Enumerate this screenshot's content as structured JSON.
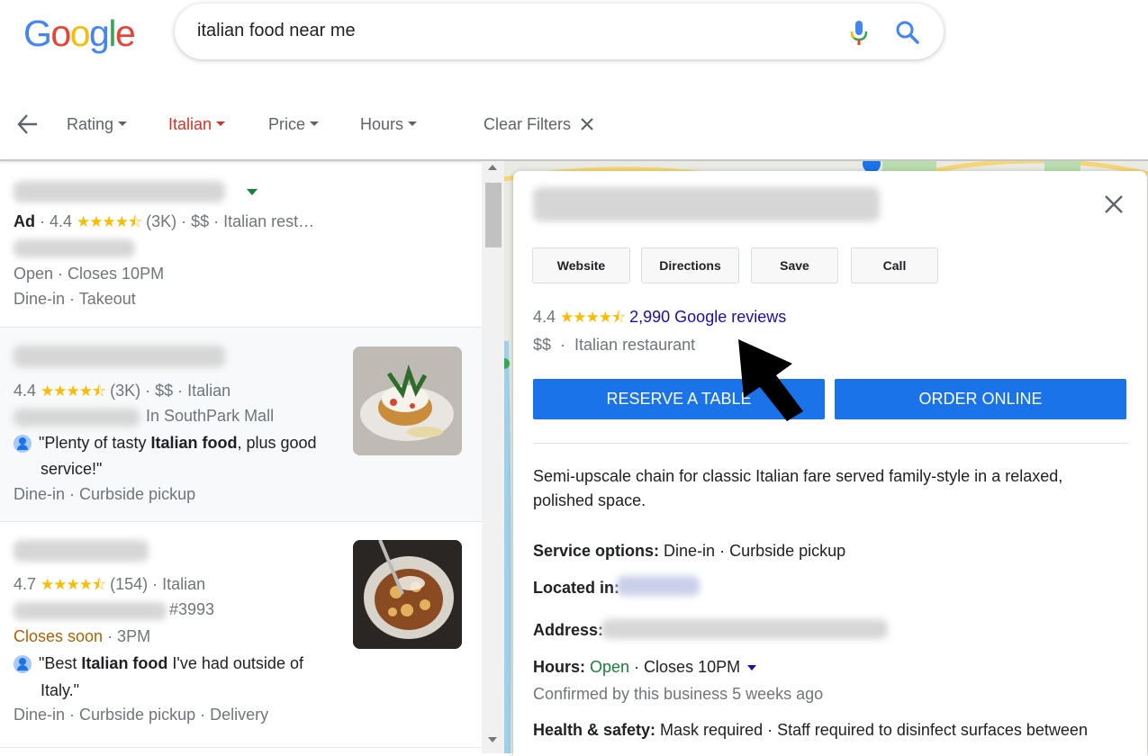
{
  "header": {
    "logo_letters": [
      "G",
      "o",
      "o",
      "g",
      "l",
      "e"
    ],
    "logo_colors": [
      "#4285f4",
      "#ea4335",
      "#fbbc05",
      "#4285f4",
      "#34a853",
      "#ea4335"
    ],
    "search_query": "italian food near me"
  },
  "filters": {
    "back_icon": "arrow-left-icon",
    "chips": [
      {
        "label": "Rating",
        "active": false
      },
      {
        "label": "Italian",
        "active": true
      },
      {
        "label": "Price",
        "active": false
      },
      {
        "label": "Hours",
        "active": false
      }
    ],
    "clear_label": "Clear Filters",
    "clear_icon": "close-icon",
    "active_color": "#d93025"
  },
  "results": [
    {
      "ad_label": "Ad",
      "rating": "4.4",
      "stars": "★★★★⯪",
      "meta": "(3K) · $$ · Italian rest…",
      "hours": "Open · Closes 10PM",
      "services": "Dine-in · Takeout"
    },
    {
      "rating": "4.4",
      "stars": "★★★★⯪",
      "meta": "(3K) · $$ · Italian",
      "location_suffix": "In SouthPark Mall",
      "review_pre": "\"Plenty of tasty ",
      "review_bold": "Italian food",
      "review_post": ", plus good",
      "review_line2": "service!\"",
      "services": "Dine-in · Curbside pickup"
    },
    {
      "rating": "4.7",
      "stars": "★★★★⯪",
      "meta": "(154) · Italian",
      "address_suffix": "#3993",
      "hours_status": "Closes soon",
      "hours_rest": " · 3PM",
      "review_pre": "\"Best ",
      "review_bold": "Italian food",
      "review_post": " I've had outside of",
      "review_line2": "Italy.\"",
      "services": "Dine-in · Curbside pickup · Delivery"
    }
  ],
  "panel": {
    "buttons": [
      "Website",
      "Directions",
      "Save",
      "Call"
    ],
    "rating": "4.4",
    "stars": "★★★★⯪",
    "reviews_link": "2,990 Google reviews",
    "price": "$$",
    "category": "Italian restaurant",
    "reserve_label": "RESERVE A TABLE",
    "order_label": "ORDER ONLINE",
    "description_line1": "Semi-upscale chain for classic Italian fare served family-style in a relaxed,",
    "description_line2": "polished space.",
    "service_label": "Service options:",
    "service_value": " Dine-in · Curbside pickup",
    "located_label": "Located in:",
    "address_label": "Address:",
    "hours_label": "Hours:",
    "hours_open": " Open",
    "hours_rest": " · Closes 10PM",
    "confirmed": "Confirmed by this business 5 weeks ago",
    "health_label": "Health & safety:",
    "health_value": " Mask required · Staff required to disinfect surfaces between",
    "close_icon": "close-icon",
    "brand_blue": "#1a73e8"
  }
}
